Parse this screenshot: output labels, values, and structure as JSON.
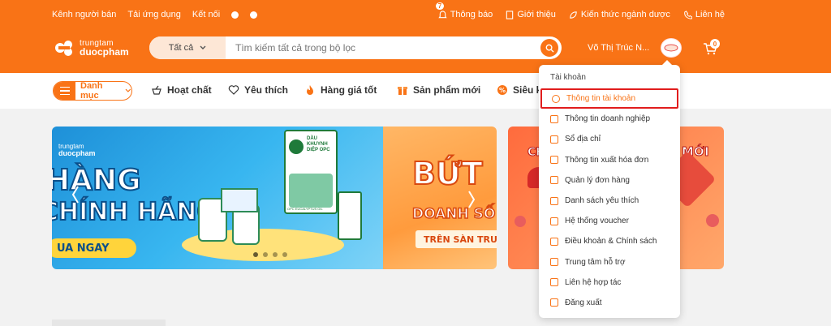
{
  "topbar": {
    "left": [
      "Kênh người bán",
      "Tải ứng dụng",
      "Kết nối"
    ],
    "notifications": {
      "label": "Thông báo",
      "count": "7"
    },
    "right": [
      "Giới thiệu",
      "Kiến thức ngành dược",
      "Liên hệ"
    ]
  },
  "logo": {
    "line1": "trungtam",
    "line2": "duocpham"
  },
  "search": {
    "category": "Tất cả",
    "placeholder": "Tìm kiếm tất cả trong bộ lọc"
  },
  "user": {
    "name": "Võ Thị Trúc N..."
  },
  "cart": {
    "count": "0"
  },
  "nav": {
    "menu_label": "Danh mục",
    "items": [
      "Hoạt chất",
      "Yêu thích",
      "Hàng giá tốt",
      "Sản phẩm mới",
      "Siêu k"
    ]
  },
  "banners": {
    "a_brand": [
      "trungtam",
      "duocpham"
    ],
    "a_headline": [
      "HÀNG",
      "CHÍNH HÃNG"
    ],
    "a_cta": "UA NGAY",
    "a_product": [
      "DẦU",
      "KHUYNH",
      "DIỆP OPC",
      "OPC EUCALYPTUS OIL"
    ],
    "b_headline": [
      "BỨT",
      "DOANH SỐ"
    ],
    "b_sub": "TRÊN SÀN TRUN",
    "c_headline": [
      "CH",
      "MỚI"
    ]
  },
  "account_menu": {
    "title": "Tài khoản",
    "items": [
      "Thông tin tài khoản",
      "Thông tin doanh nghiệp",
      "Sổ địa chỉ",
      "Thông tin xuất hóa đơn",
      "Quản lý đơn hàng",
      "Danh sách yêu thích",
      "Hệ thống voucher",
      "Điều khoản & Chính sách",
      "Trung tâm hỗ trợ",
      "Liên hệ hợp tác",
      "Đăng xuất"
    ],
    "active_index": 0
  },
  "colors": {
    "brand": "#f97316",
    "highlight": "#e11d1d"
  }
}
